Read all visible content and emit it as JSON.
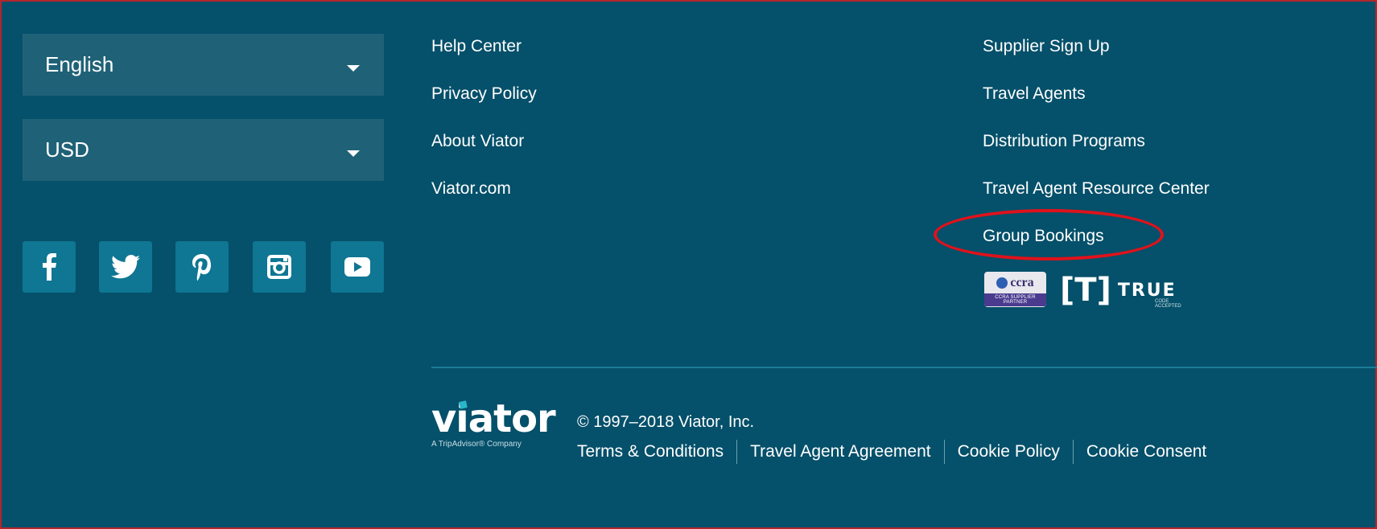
{
  "selects": {
    "language": "English",
    "currency": "USD"
  },
  "social": [
    {
      "name": "facebook-icon"
    },
    {
      "name": "twitter-icon"
    },
    {
      "name": "pinterest-icon"
    },
    {
      "name": "instagram-icon"
    },
    {
      "name": "youtube-icon"
    }
  ],
  "links_col1": [
    "Help Center",
    "Privacy Policy",
    "About Viator",
    "Viator.com"
  ],
  "links_col2": [
    "Supplier Sign Up",
    "Travel Agents",
    "Distribution Programs",
    "Travel Agent Resource Center",
    "Group Bookings"
  ],
  "badges": {
    "ccra_word": "ccra",
    "ccra_sub": "CCRA SUPPLIER PARTNER",
    "true_bracket": "[T]",
    "true_word": "TRUE",
    "true_tag": "CODE ACCEPTED"
  },
  "brand": {
    "logo_word": "viator",
    "logo_tagline": "A TripAdvisor® Company",
    "copyright": "© 1997–2018 Viator, Inc."
  },
  "legal_links": [
    "Terms & Conditions",
    "Travel Agent Agreement",
    "Cookie Policy",
    "Cookie Consent"
  ],
  "colors": {
    "background": "#05506a",
    "select_bg": "#1f6277",
    "social_bg": "#0f7693",
    "annotation": "#e0121b"
  }
}
